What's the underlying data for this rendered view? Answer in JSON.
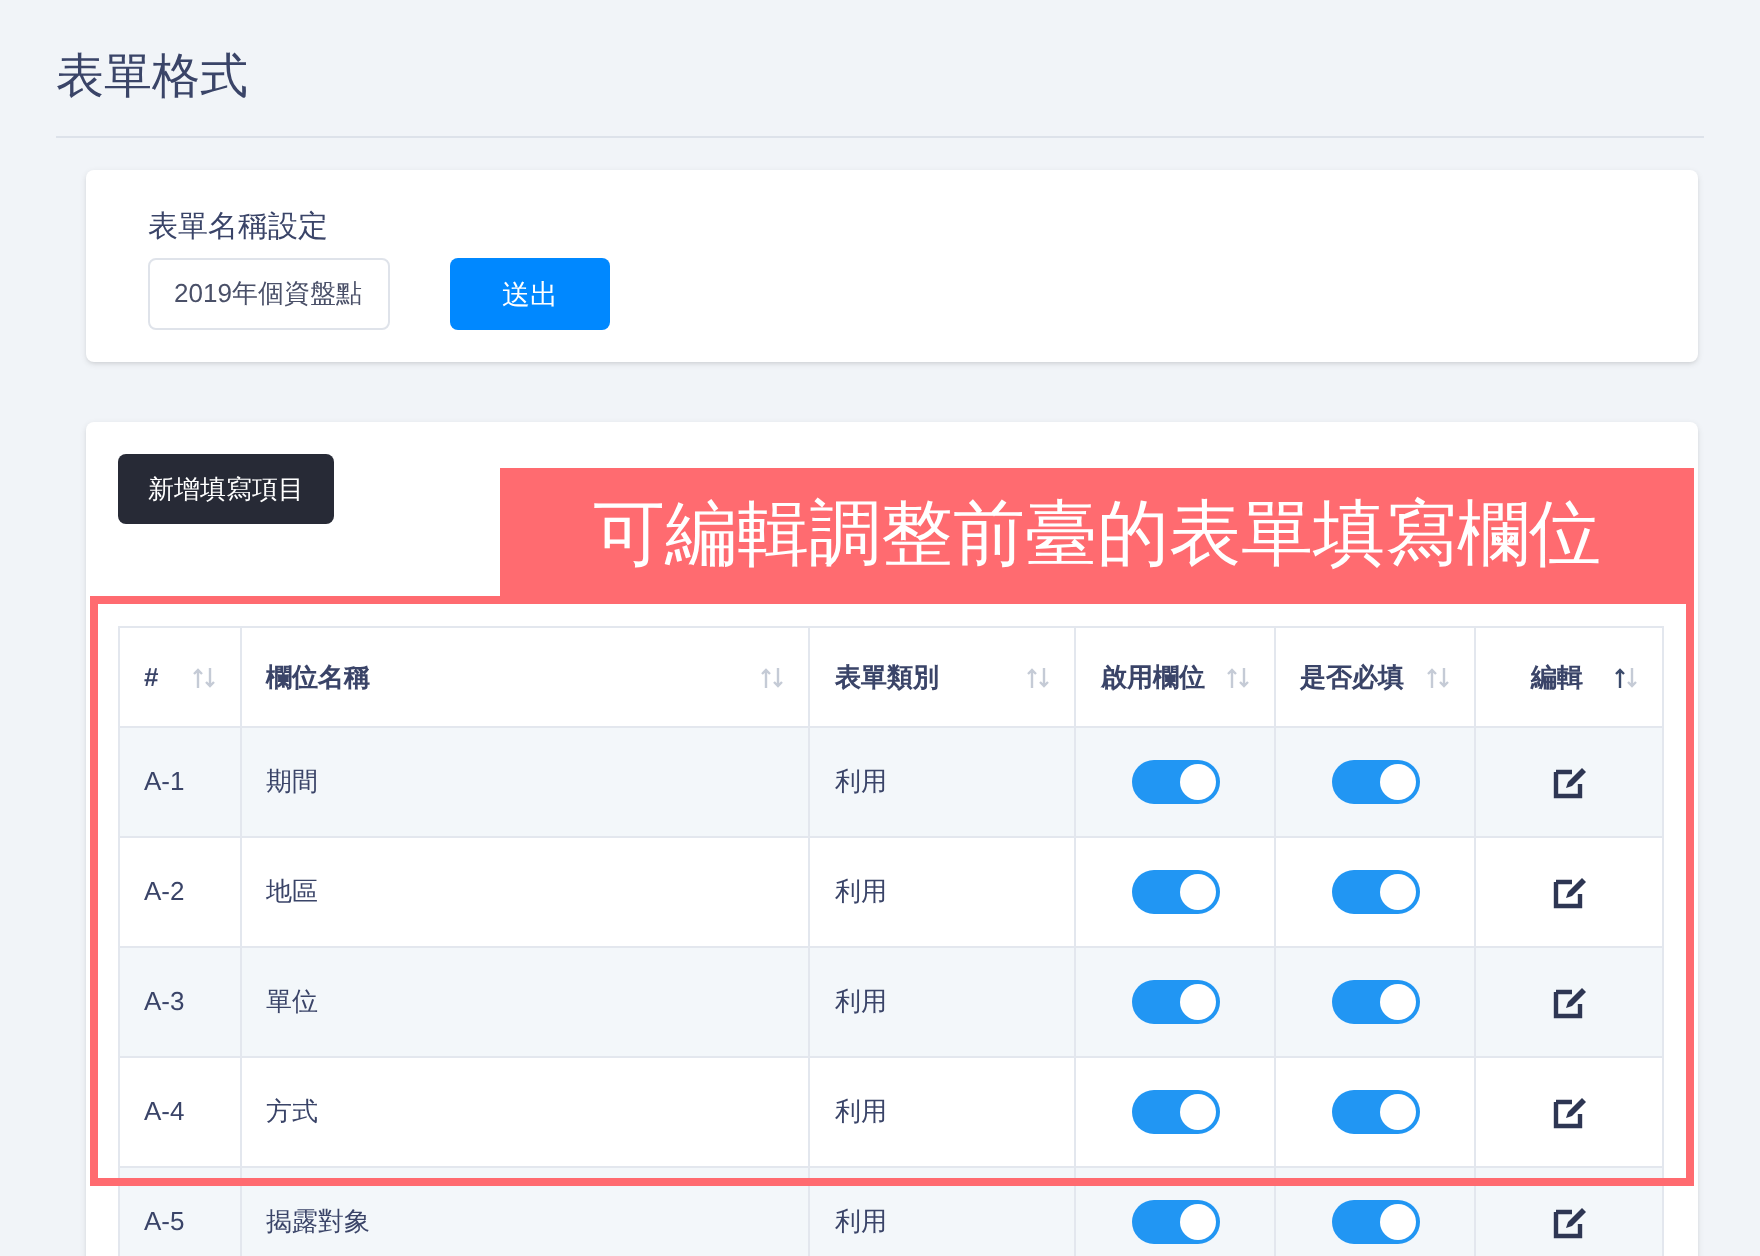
{
  "page": {
    "title": "表單格式"
  },
  "form_name": {
    "label": "表單名稱設定",
    "value": "2019年個資盤點",
    "submit": "送出"
  },
  "add_button": "新增填寫項目",
  "annotation": {
    "text": "可編輯調整前臺的表單填寫欄位"
  },
  "table": {
    "columns": [
      {
        "label": "#",
        "sorted": false
      },
      {
        "label": "欄位名稱",
        "sorted": false
      },
      {
        "label": "表單類別",
        "sorted": false
      },
      {
        "label": "啟用欄位",
        "sorted": false
      },
      {
        "label": "是否必填",
        "sorted": false
      },
      {
        "label": "編輯",
        "sorted": true
      }
    ],
    "rows": [
      {
        "id": "A-1",
        "name": "期間",
        "category": "利用",
        "enabled": true,
        "required": true
      },
      {
        "id": "A-2",
        "name": "地區",
        "category": "利用",
        "enabled": true,
        "required": true
      },
      {
        "id": "A-3",
        "name": "單位",
        "category": "利用",
        "enabled": true,
        "required": true
      },
      {
        "id": "A-4",
        "name": "方式",
        "category": "利用",
        "enabled": true,
        "required": true
      },
      {
        "id": "A-5",
        "name": "揭露對象",
        "category": "利用",
        "enabled": true,
        "required": true
      }
    ]
  }
}
